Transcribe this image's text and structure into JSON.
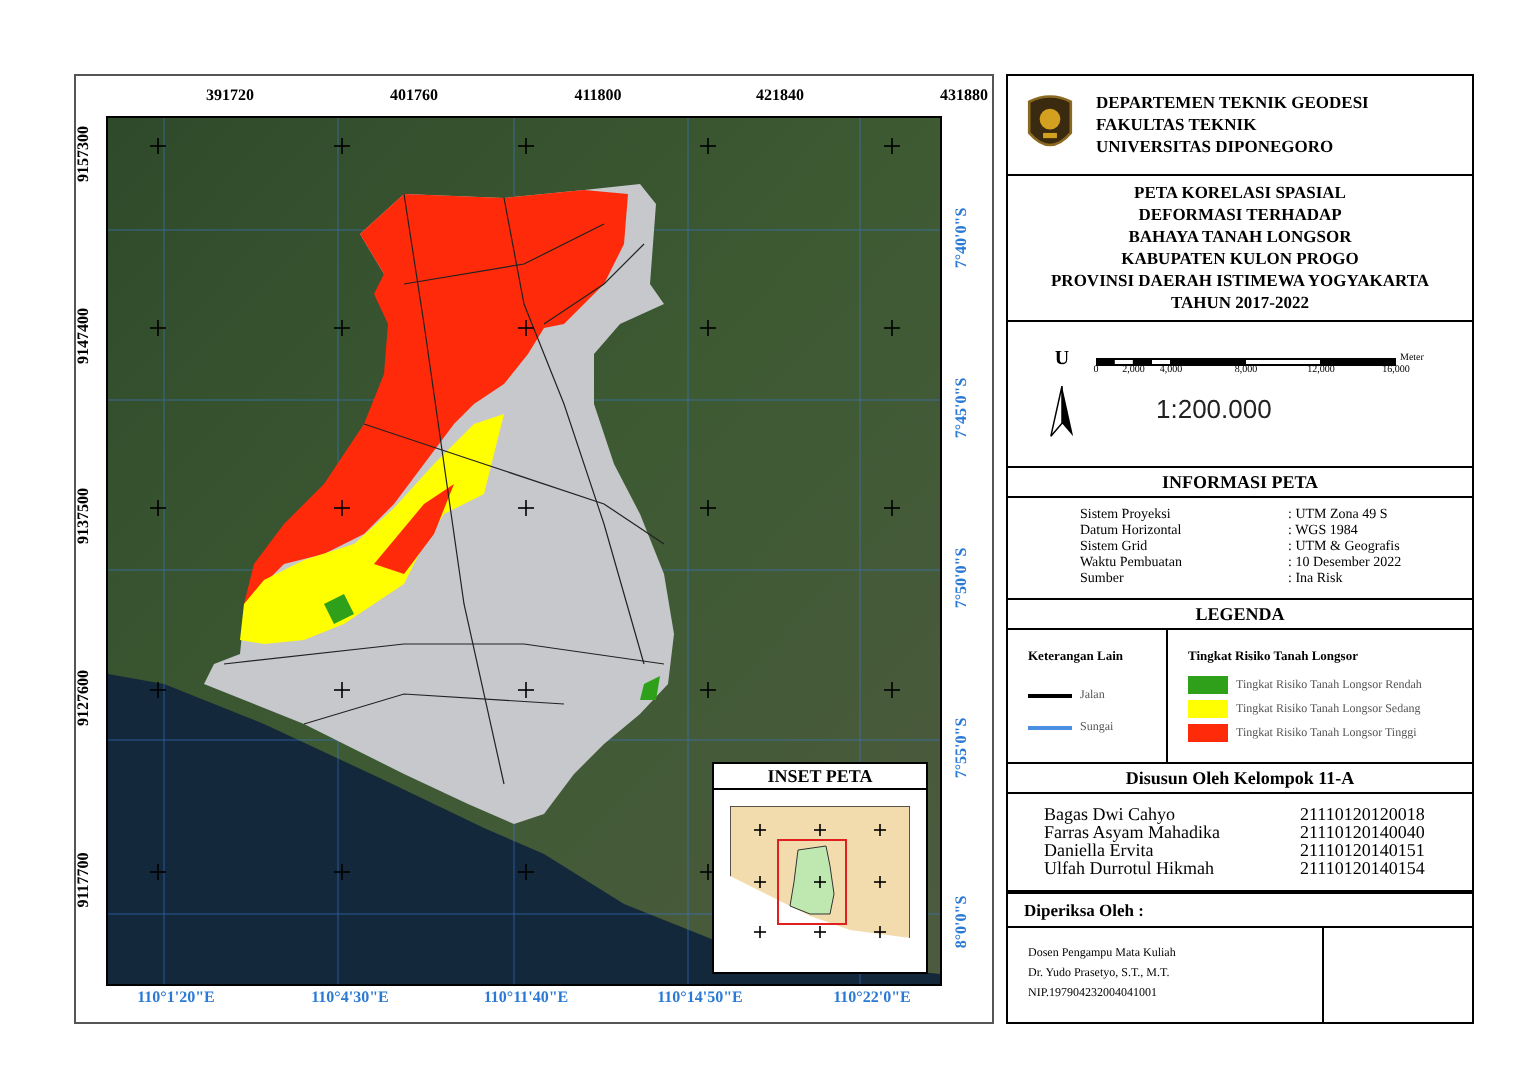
{
  "map": {
    "x_ticks": [
      "391720",
      "401760",
      "411800",
      "421840",
      "431880"
    ],
    "y_ticks": [
      "9157300",
      "9147400",
      "9137500",
      "9127600",
      "9117700"
    ],
    "lat_labels": [
      "7°40'0\"S",
      "7°45'0\"S",
      "7°50'0\"S",
      "7°55'0\"S",
      "8°0'0\"S"
    ],
    "lon_labels": [
      "110°1'20\"E",
      "110°4'30\"E",
      "110°11'40\"E",
      "110°14'50\"E",
      "110°22'0\"E"
    ],
    "inset": {
      "title": "INSET PETA"
    }
  },
  "header": {
    "lines": [
      "DEPARTEMEN TEKNIK GEODESI",
      "FAKULTAS TEKNIK",
      "UNIVERSITAS DIPONEGORO"
    ]
  },
  "title_lines": [
    "PETA KORELASI SPASIAL",
    "DEFORMASI TERHADAP",
    "BAHAYA TANAH LONGSOR",
    "KABUPATEN KULON PROGO",
    "PROVINSI DAERAH ISTIMEWA YOGYAKARTA",
    "TAHUN 2017-2022"
  ],
  "north_label": "U",
  "scale_bar": {
    "unit": "Meter",
    "ticks": [
      "0",
      "2,000",
      "4,000",
      "8,000",
      "12,000",
      "16,000"
    ]
  },
  "scale_text": "1:200.000",
  "info": {
    "title": "INFORMASI PETA",
    "rows": [
      {
        "label": "Sistem Proyeksi",
        "value": ": UTM Zona 49 S"
      },
      {
        "label": "Datum Horizontal",
        "value": ": WGS 1984"
      },
      {
        "label": "Sistem Grid",
        "value": ": UTM & Geografis"
      },
      {
        "label": "Waktu Pembuatan",
        "value": ": 10 Desember 2022"
      },
      {
        "label": "Sumber",
        "value": ": Ina Risk"
      }
    ]
  },
  "legend": {
    "title": "LEGENDA",
    "other": {
      "title": "Keterangan Lain",
      "items": [
        {
          "label": "Jalan",
          "color": "#000000"
        },
        {
          "label": "Sungai",
          "color": "#4a90e2"
        }
      ]
    },
    "risk": {
      "title": "Tingkat Risiko Tanah Longsor",
      "items": [
        {
          "label": "Tingkat Risiko Tanah Longsor Rendah",
          "color": "#2ea01a"
        },
        {
          "label": "Tingkat Risiko Tanah Longsor Sedang",
          "color": "#ffff00"
        },
        {
          "label": "Tingkat Risiko Tanah Longsor Tinggi",
          "color": "#ff2a0a"
        }
      ]
    }
  },
  "team": {
    "title": "Disusun Oleh Kelompok 11-A",
    "members": [
      {
        "name": "Bagas Dwi Cahyo",
        "nim": "21110120120018"
      },
      {
        "name": "Farras Asyam Mahadika",
        "nim": "21110120140040"
      },
      {
        "name": "Daniella Ervita",
        "nim": "21110120140151"
      },
      {
        "name": "Ulfah Durrotul Hikmah",
        "nim": "21110120140154"
      }
    ]
  },
  "checked_by": {
    "title": "Diperiksa Oleh :",
    "lines": [
      "Dosen Pengampu Mata Kuliah",
      "Dr. Yudo Prasetyo, S.T., M.T.",
      "NIP.197904232004041001"
    ]
  }
}
